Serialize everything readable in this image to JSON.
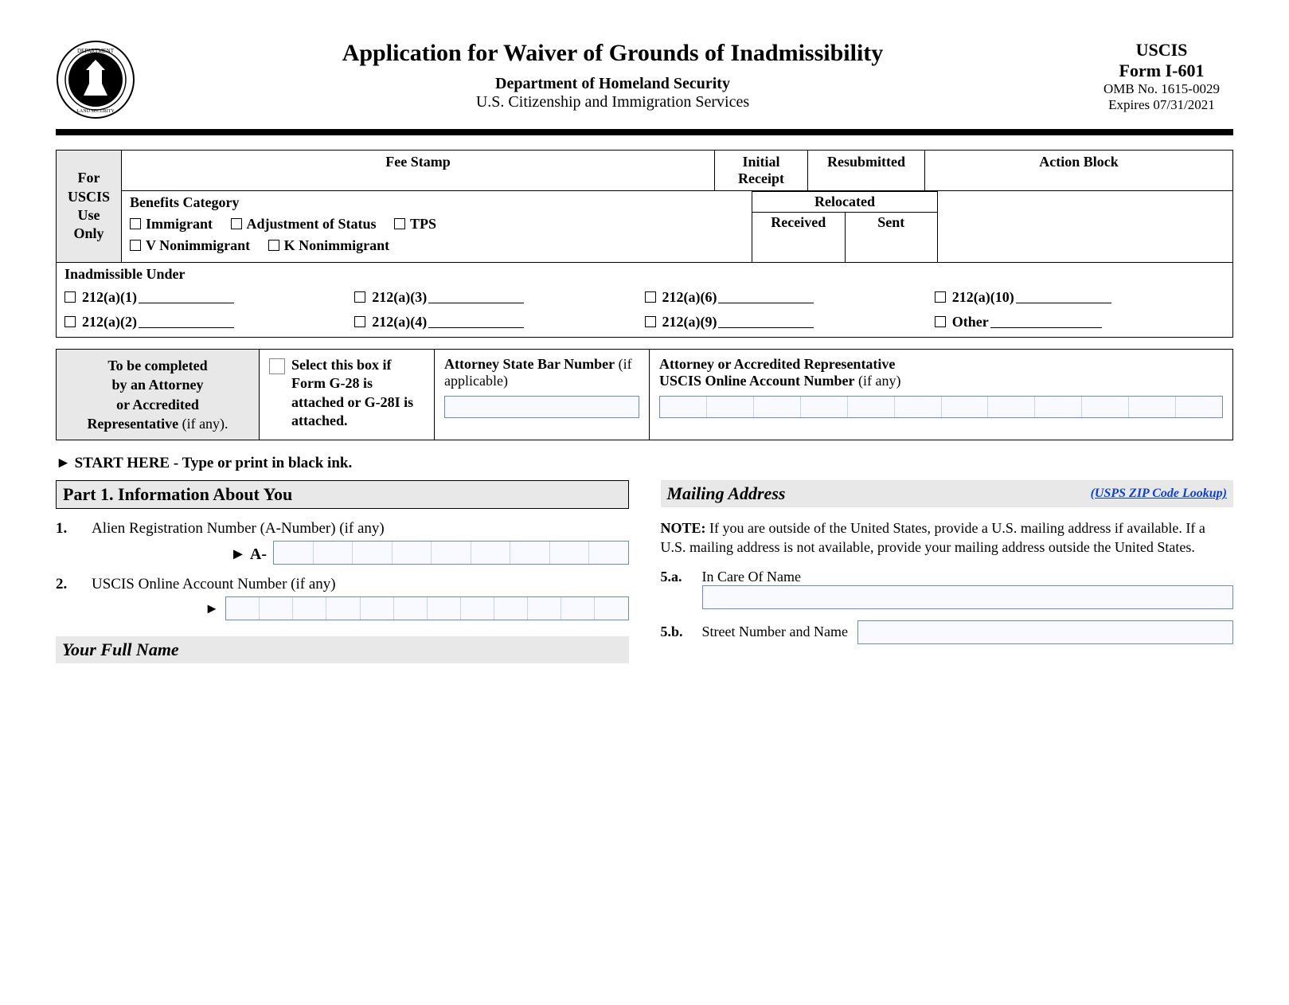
{
  "header": {
    "title": "Application for Waiver of Grounds of Inadmissibility",
    "dept": "Department of Homeland Security",
    "subdept": "U.S. Citizenship and Immigration Services",
    "agency": "USCIS",
    "form": "Form I-601",
    "omb": "OMB No. 1615-0029",
    "expires": "Expires 07/31/2021"
  },
  "uscis": {
    "for_use": "For USCIS Use Only",
    "fee_stamp": "Fee Stamp",
    "initial": "Initial Receipt",
    "resubmitted": "Resubmitted",
    "action_block": "Action Block",
    "relocated": "Relocated",
    "received": "Received",
    "sent": "Sent",
    "benefits_title": "Benefits Category",
    "benefits": [
      "Immigrant",
      "Adjustment of Status",
      "TPS",
      "V Nonimmigrant",
      "K Nonimmigrant"
    ],
    "inadm_title": "Inadmissible Under",
    "inadm": [
      "212(a)(1)",
      "212(a)(3)",
      "212(a)(6)",
      "212(a)(10)",
      "212(a)(2)",
      "212(a)(4)",
      "212(a)(9)",
      "Other"
    ]
  },
  "atty": {
    "c1_l1": "To be completed",
    "c1_l2": "by an Attorney",
    "c1_l3": "or Accredited",
    "c1_l4_a": "Representative",
    "c1_l4_b": " (if any).",
    "c2": "Select this box if Form G-28 is attached or G-28I is attached.",
    "c3_label": "Attorney State Bar Number",
    "c3_sub": "(if applicable)",
    "c4_l1": "Attorney or Accredited Representative",
    "c4_l2a": "USCIS Online Account Number",
    "c4_l2b": " (if any)"
  },
  "start_here": "START HERE - Type or print in black ink.",
  "part1": {
    "title": "Part 1.  Information About You",
    "q1_num": "1.",
    "q1": "Alien Registration Number (A-Number) (if any)",
    "q1_prefix": "A-",
    "q2_num": "2.",
    "q2": "USCIS Online Account Number (if any)",
    "full_name": "Your Full Name"
  },
  "mailing": {
    "title": "Mailing Address",
    "zip_link": "(USPS ZIP Code Lookup)",
    "note_bold": "NOTE:",
    "note": "  If you are outside of the United States, provide a U.S. mailing address if available.  If a U.S. mailing address is not available, provide your mailing address outside the United States.",
    "f5a_num": "5.a.",
    "f5a": "In Care Of Name",
    "f5b_num": "5.b.",
    "f5b": "Street Number and Name"
  }
}
